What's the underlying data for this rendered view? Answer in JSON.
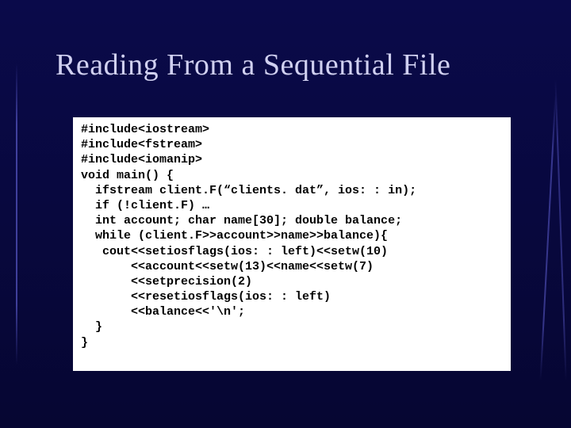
{
  "slide": {
    "title": "Reading From a Sequential File",
    "code": "#include<iostream>\n#include<fstream>\n#include<iomanip>\nvoid main() {\n  ifstream client.F(“clients. dat”, ios: : in);\n  if (!client.F) …\n  int account; char name[30]; double balance;\n  while (client.F>>account>>name>>balance){\n   cout<<setiosflags(ios: : left)<<setw(10)\n       <<account<<setw(13)<<name<<setw(7)\n       <<setprecision(2)\n       <<resetiosflags(ios: : left)\n       <<balance<<'\\n';\n  }\n}"
  }
}
